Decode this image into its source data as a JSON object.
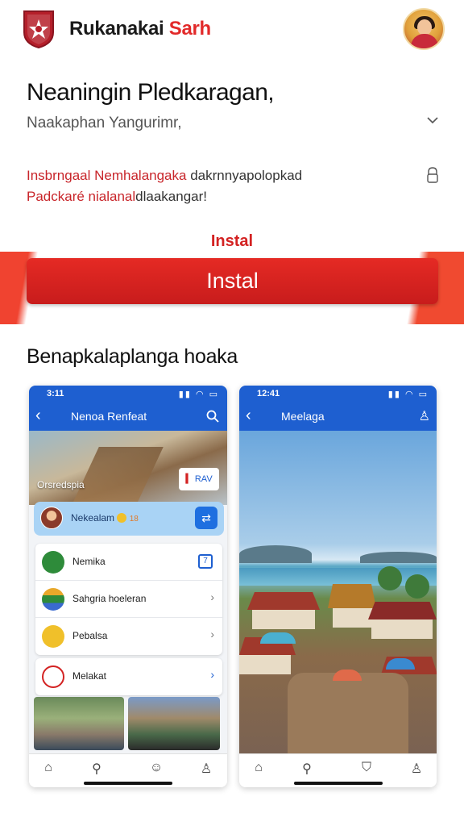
{
  "header": {
    "brand_part1": "Rukanakai ",
    "brand_part2": "Sarh"
  },
  "intro": {
    "title": "Neaningin Pledkaragan,",
    "subtitle": "Naakaphan Yangurimr,",
    "description_line1_red": "Insbrngaal Nemhalangaka",
    "description_line1_dark": " dakrnnyapolopkad",
    "description_line2_red": "Padckaré nialanal",
    "description_line2_dark": "dlaakangar!"
  },
  "install": {
    "label": "Instal",
    "button_label": "Instal"
  },
  "gallery": {
    "title": "Benapkalaplanga hoaka",
    "screens": [
      {
        "status_time": "3:11",
        "title": "Nenoa Renfeat",
        "hero_label": "Orsredspia",
        "hero_badge": "RAV",
        "highlight_text": "Nekealam",
        "highlight_badge": "18",
        "items": [
          {
            "label": "Nemika",
            "icon": "mosque-icon",
            "icon_color": "#2e8b3a"
          },
          {
            "label": "Sahgria hoeleran",
            "icon": "flag-icon",
            "icon_color": "#e8a82a"
          },
          {
            "label": "Pebalsa",
            "icon": "pizza-icon",
            "icon_color": "#f0c02a"
          },
          {
            "label": "Melakat",
            "icon": "tools-icon",
            "icon_color": "#d32222"
          }
        ]
      },
      {
        "status_time": "12:41",
        "title": "Meelaga"
      }
    ]
  },
  "colors": {
    "accent_red": "#d32222",
    "app_blue": "#1e5fd0"
  }
}
